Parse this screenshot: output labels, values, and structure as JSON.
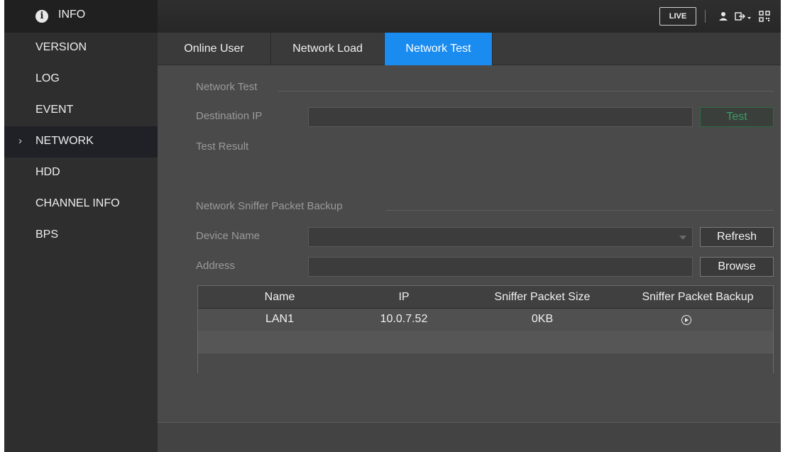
{
  "app": {
    "title": "INFO",
    "info_icon": "info-icon"
  },
  "topbar": {
    "live_label": "LIVE",
    "icons": [
      "user-icon",
      "logout-icon",
      "qr-code-icon"
    ]
  },
  "sidebar": {
    "items": [
      {
        "label": "VERSION"
      },
      {
        "label": "LOG"
      },
      {
        "label": "EVENT"
      },
      {
        "label": "NETWORK",
        "active": true,
        "indicator": "›"
      },
      {
        "label": "HDD"
      },
      {
        "label": "CHANNEL INFO"
      },
      {
        "label": "BPS"
      }
    ]
  },
  "tabs": [
    {
      "label": "Online User"
    },
    {
      "label": "Network Load"
    },
    {
      "label": "Network Test",
      "active": true
    }
  ],
  "network_test": {
    "section_title": "Network Test",
    "destination_ip_label": "Destination IP",
    "destination_ip_value": "",
    "test_button": "Test",
    "test_result_label": "Test Result"
  },
  "sniffer": {
    "section_title": "Network Sniffer Packet Backup",
    "device_name_label": "Device Name",
    "device_name_value": "",
    "refresh_button": "Refresh",
    "address_label": "Address",
    "address_value": "",
    "browse_button": "Browse",
    "table": {
      "headers": [
        "Name",
        "IP",
        "Sniffer Packet Size",
        "Sniffer Packet Backup"
      ],
      "rows": [
        {
          "name": "LAN1",
          "ip": "10.0.7.52",
          "size": "0KB",
          "backup_icon": "play-circle-icon"
        }
      ]
    }
  },
  "colors": {
    "accent": "#1a8cf0",
    "test_button_text": "#3a9c63"
  }
}
